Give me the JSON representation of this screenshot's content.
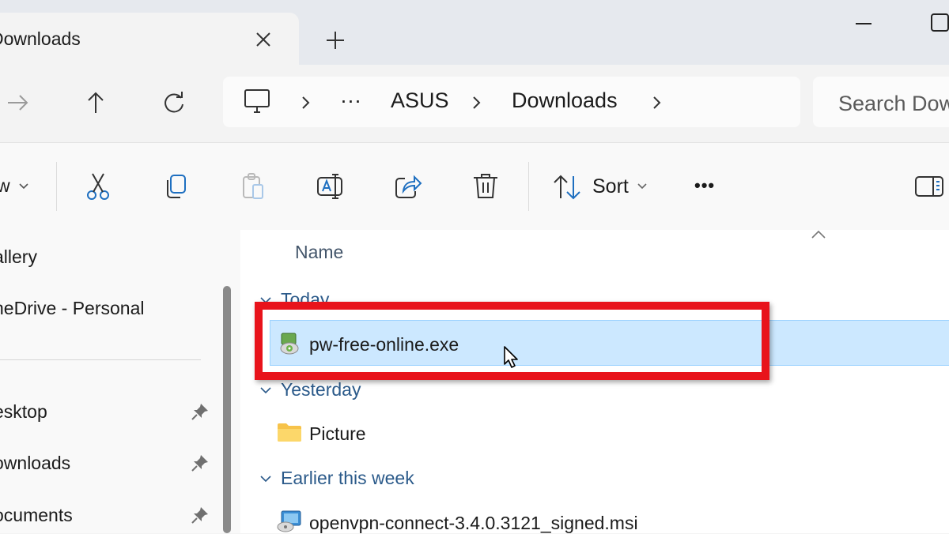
{
  "tab": {
    "title": "Downloads",
    "close_icon": "close-icon",
    "new_tab_icon": "plus-icon"
  },
  "window": {
    "minimize_icon": "minimize-icon",
    "maximize_icon": "maximize-icon"
  },
  "nav": {
    "forward_icon": "arrow-right-icon",
    "up_icon": "arrow-up-icon",
    "refresh_icon": "refresh-icon"
  },
  "address": {
    "root_icon": "monitor-icon",
    "overflow": "···",
    "crumbs": [
      "ASUS",
      "Downloads"
    ]
  },
  "search": {
    "placeholder": "Search Downloads"
  },
  "commandbar": {
    "new_label": "w",
    "sort_label": "Sort",
    "more_label": "•••",
    "icons": [
      "cut-icon",
      "copy-icon",
      "paste-icon",
      "rename-icon",
      "share-icon",
      "delete-icon",
      "sort-icon",
      "details-pane-icon"
    ]
  },
  "sidebar": {
    "items": [
      {
        "label": "allery"
      },
      {
        "label": "neDrive - Personal"
      },
      {
        "label": "esktop",
        "pinned": true
      },
      {
        "label": "ownloads",
        "pinned": true
      },
      {
        "label": "ocuments",
        "pinned": true
      }
    ]
  },
  "filelist": {
    "column_name": "Name",
    "groups": [
      {
        "label": "Today",
        "files": [
          {
            "name": "pw-free-online.exe",
            "icon": "exe-installer-icon",
            "selected": true
          }
        ]
      },
      {
        "label": "Yesterday",
        "files": [
          {
            "name": "Picture",
            "icon": "folder-icon"
          }
        ]
      },
      {
        "label": "Earlier this week",
        "files": [
          {
            "name": "openvpn-connect-3.4.0.3121_signed.msi",
            "icon": "msi-installer-icon"
          }
        ]
      }
    ]
  },
  "colors": {
    "highlight": "#e8131b",
    "selection": "#cce8ff",
    "group_text": "#2b5a8a",
    "folder": "#f7c34a"
  }
}
